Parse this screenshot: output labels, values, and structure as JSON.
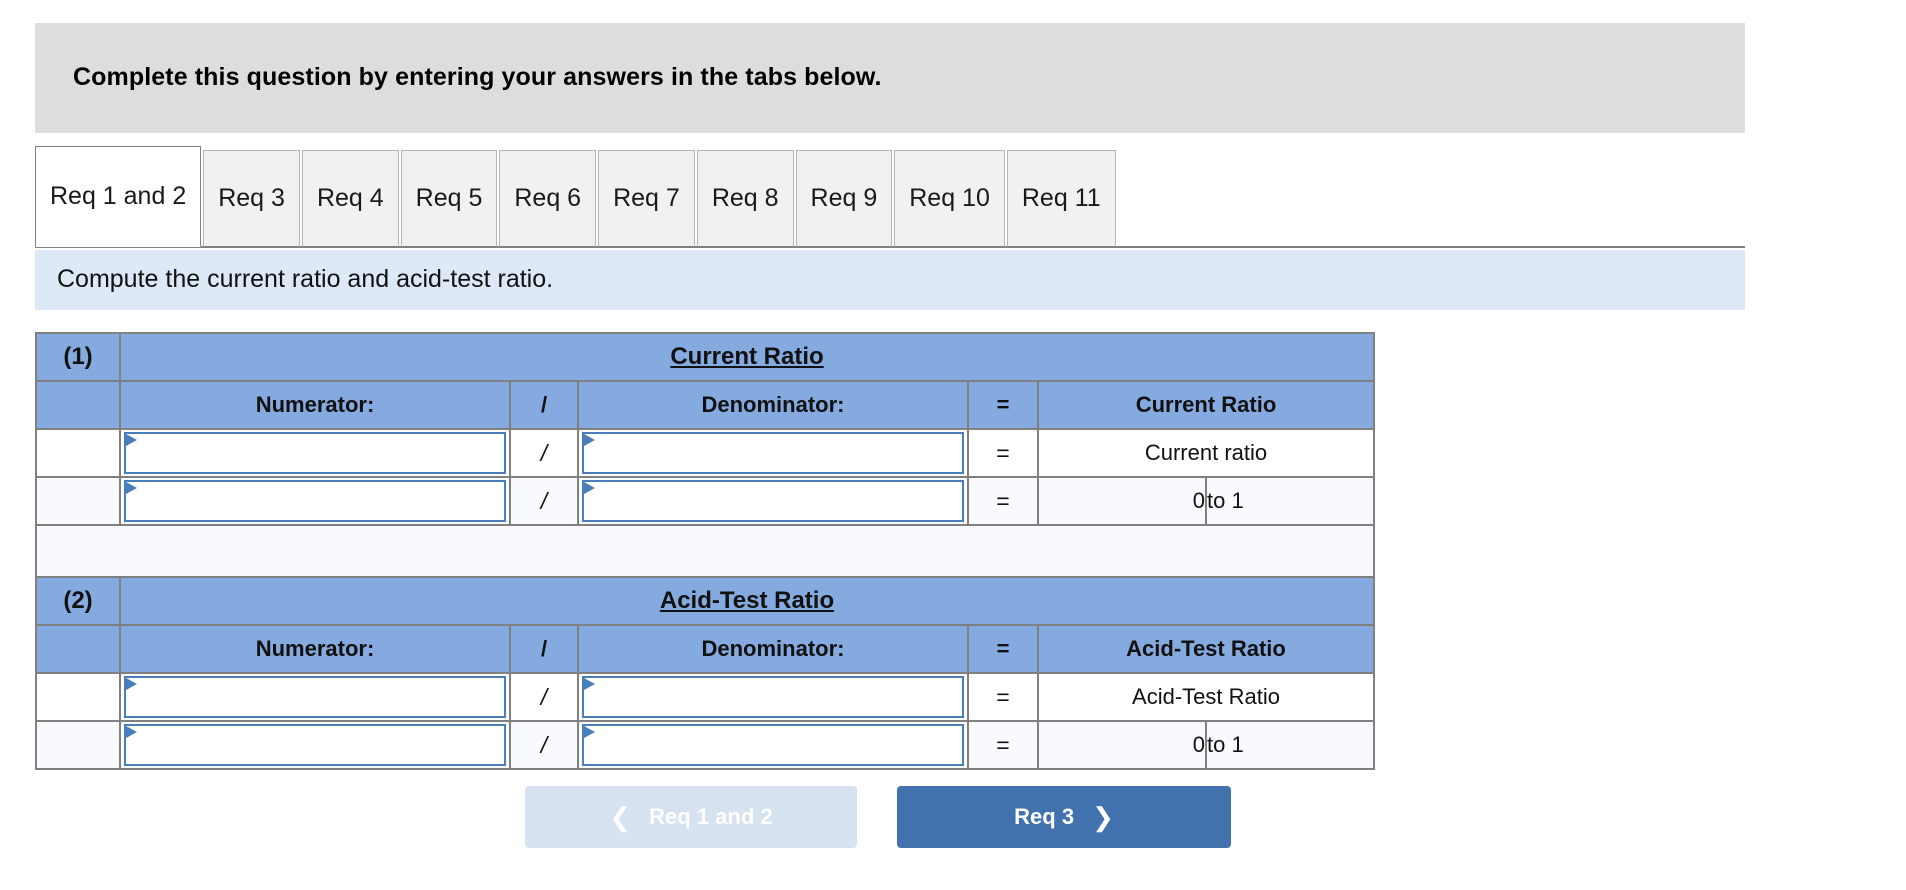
{
  "banner": {
    "text": "Complete this question by entering your answers in the tabs below."
  },
  "tabs": [
    {
      "label": "Req 1 and 2",
      "active": true
    },
    {
      "label": "Req 3",
      "active": false
    },
    {
      "label": "Req 4",
      "active": false
    },
    {
      "label": "Req 5",
      "active": false
    },
    {
      "label": "Req 6",
      "active": false
    },
    {
      "label": "Req 7",
      "active": false
    },
    {
      "label": "Req 8",
      "active": false
    },
    {
      "label": "Req 9",
      "active": false
    },
    {
      "label": "Req 10",
      "active": false
    },
    {
      "label": "Req 11",
      "active": false
    }
  ],
  "requirement": {
    "text": "Compute the current ratio and acid-test ratio."
  },
  "worksheet": {
    "blocks": [
      {
        "index_label": "(1)",
        "title": "Current Ratio",
        "headers": {
          "numerator": "Numerator:",
          "slash": "/",
          "denominator": "Denominator:",
          "equals": "=",
          "result": "Current Ratio"
        },
        "rows": [
          {
            "numerator_value": "",
            "slash": "/",
            "denominator_value": "",
            "equals": "=",
            "result_label": "Current ratio",
            "result_value": null,
            "result_suffix": null
          },
          {
            "numerator_value": "",
            "slash": "/",
            "denominator_value": "",
            "equals": "=",
            "result_label": null,
            "result_value": "0",
            "result_suffix": "to 1"
          }
        ]
      },
      {
        "index_label": "(2)",
        "title": "Acid-Test Ratio",
        "headers": {
          "numerator": "Numerator:",
          "slash": "/",
          "denominator": "Denominator:",
          "equals": "=",
          "result": "Acid-Test Ratio"
        },
        "rows": [
          {
            "numerator_value": "",
            "slash": "/",
            "denominator_value": "",
            "equals": "=",
            "result_label": "Acid-Test Ratio",
            "result_value": null,
            "result_suffix": null
          },
          {
            "numerator_value": "",
            "slash": "/",
            "denominator_value": "",
            "equals": "=",
            "result_label": null,
            "result_value": "0",
            "result_suffix": "to 1"
          }
        ]
      }
    ]
  },
  "navigation": {
    "prev_label": "Req 1 and 2",
    "prev_icon": "chevron-left-icon",
    "next_label": "Req 3",
    "next_icon": "chevron-right-icon"
  },
  "colors": {
    "banner_gray": "#dddddd",
    "requirement_blue": "#dde9f7",
    "header_blue": "#85aadf",
    "input_border_blue": "#4a7ebb",
    "next_button_blue": "#4272ad",
    "prev_button_blue": "#d6e2f0"
  }
}
